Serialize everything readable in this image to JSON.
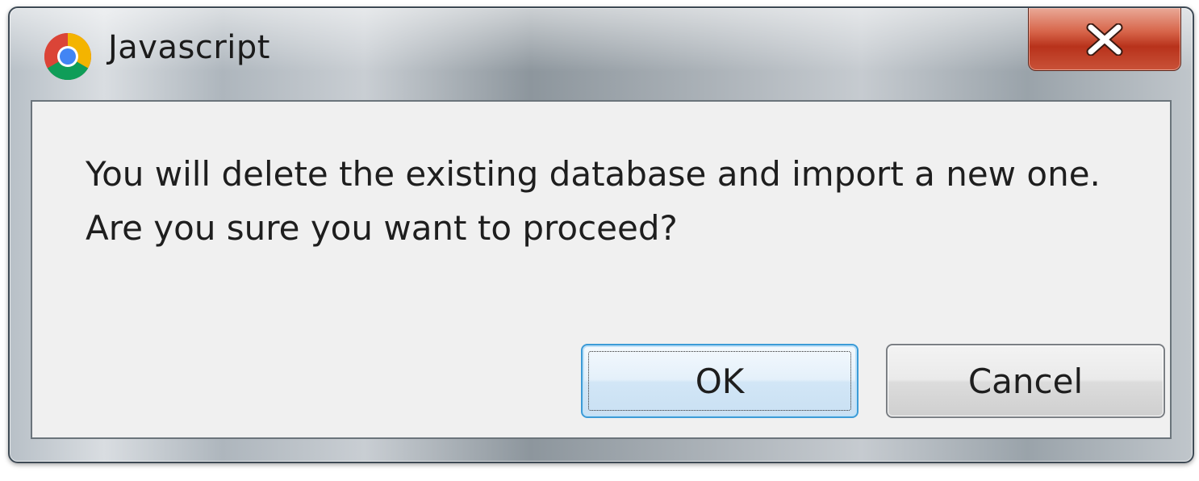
{
  "window": {
    "title": "Javascript",
    "app_icon": "chrome-icon",
    "close_icon": "close-icon",
    "close_color": "#c7452b"
  },
  "message": {
    "line1": "You will delete the existing database and import a new one.",
    "line2": "Are you sure you want to proceed?"
  },
  "buttons": {
    "ok_label": "OK",
    "cancel_label": "Cancel",
    "focused": "OK"
  }
}
